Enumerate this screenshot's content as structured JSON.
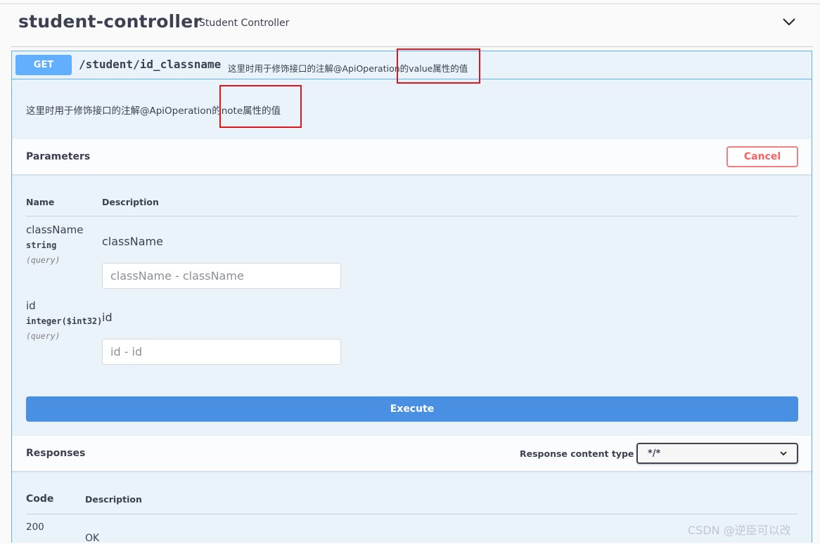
{
  "controller": {
    "title": "student-controller",
    "subtitle": "Student Controller",
    "collapse_icon": "chevron-down-icon"
  },
  "operation": {
    "method": "GET",
    "path": "/student/id_classname",
    "summary": "这里时用于修饰接口的注解@ApiOperation的value属性的值",
    "description": "这里时用于修饰接口的注解@ApiOperation的note属性的值"
  },
  "parameters": {
    "title": "Parameters",
    "cancel_label": "Cancel",
    "columns": {
      "name": "Name",
      "description": "Description"
    },
    "items": [
      {
        "name": "className",
        "type": "string",
        "in": "(query)",
        "description": "className",
        "placeholder": "className - className"
      },
      {
        "name": "id",
        "type": "integer($int32)",
        "in": "(query)",
        "description": "id",
        "placeholder": "id - id"
      }
    ]
  },
  "execute_label": "Execute",
  "responses": {
    "title": "Responses",
    "content_type_label": "Response content type",
    "content_type_value": "*/*",
    "columns": {
      "code": "Code",
      "description": "Description"
    },
    "rows": [
      {
        "code": "200",
        "description": "OK"
      }
    ]
  },
  "watermark": "CSDN @逆臣可以改",
  "colors": {
    "method_get": "#61affe",
    "execute": "#4990e2",
    "cancel": "#ff6060",
    "highlight_box": "#e3141a"
  }
}
